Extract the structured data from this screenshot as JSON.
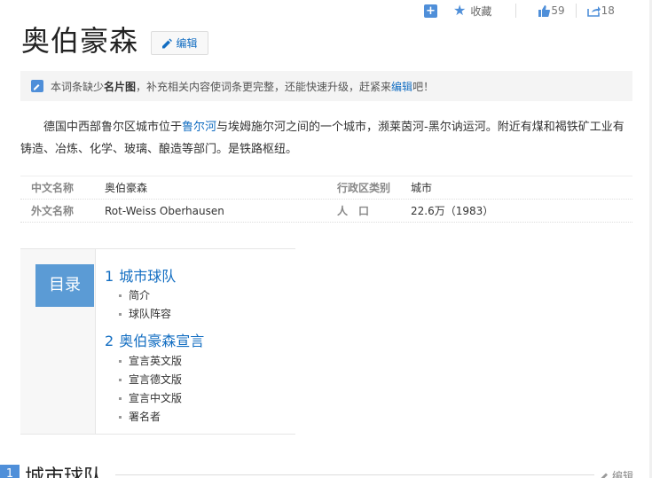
{
  "toolbar": {
    "favorite_label": "收藏",
    "like_count": "59",
    "share_count": "18"
  },
  "title": "奥伯豪森",
  "edit_label": "编辑",
  "tip": {
    "pre": "本词条缺少",
    "bold": "名片图",
    "mid": "，补充相关内容使词条更完整，还能快速升级，赶紧来",
    "link": "编辑",
    "post": "吧！"
  },
  "summary": {
    "pre": "德国中西部鲁尔区城市位于",
    "link": "鲁尔河",
    "post": "与埃姆施尔河之间的一个城市，濒莱茵河-黑尔讷运河。附近有煤和褐铁矿工业有铸造、冶炼、化学、玻璃、酿造等部门。是铁路枢纽。"
  },
  "basic_info": [
    {
      "k1": "中文名称",
      "v1": "奥伯豪森",
      "k2": "行政区类别",
      "v2": "城市"
    },
    {
      "k1": "外文名称",
      "v1": "Rot-Weiss Oberhausen",
      "k2": "人　口",
      "v2": "22.6万（1983）"
    }
  ],
  "catalog": {
    "heading": "目录",
    "sections": [
      {
        "num": "1",
        "title": "城市球队",
        "items": [
          "简介",
          "球队阵容"
        ]
      },
      {
        "num": "2",
        "title": "奥伯豪森宣言",
        "items": [
          "宣言英文版",
          "宣言德文版",
          "宣言中文版",
          "署名者"
        ]
      }
    ]
  },
  "section1": {
    "num": "1",
    "title": "城市球队",
    "edit": "编辑"
  }
}
